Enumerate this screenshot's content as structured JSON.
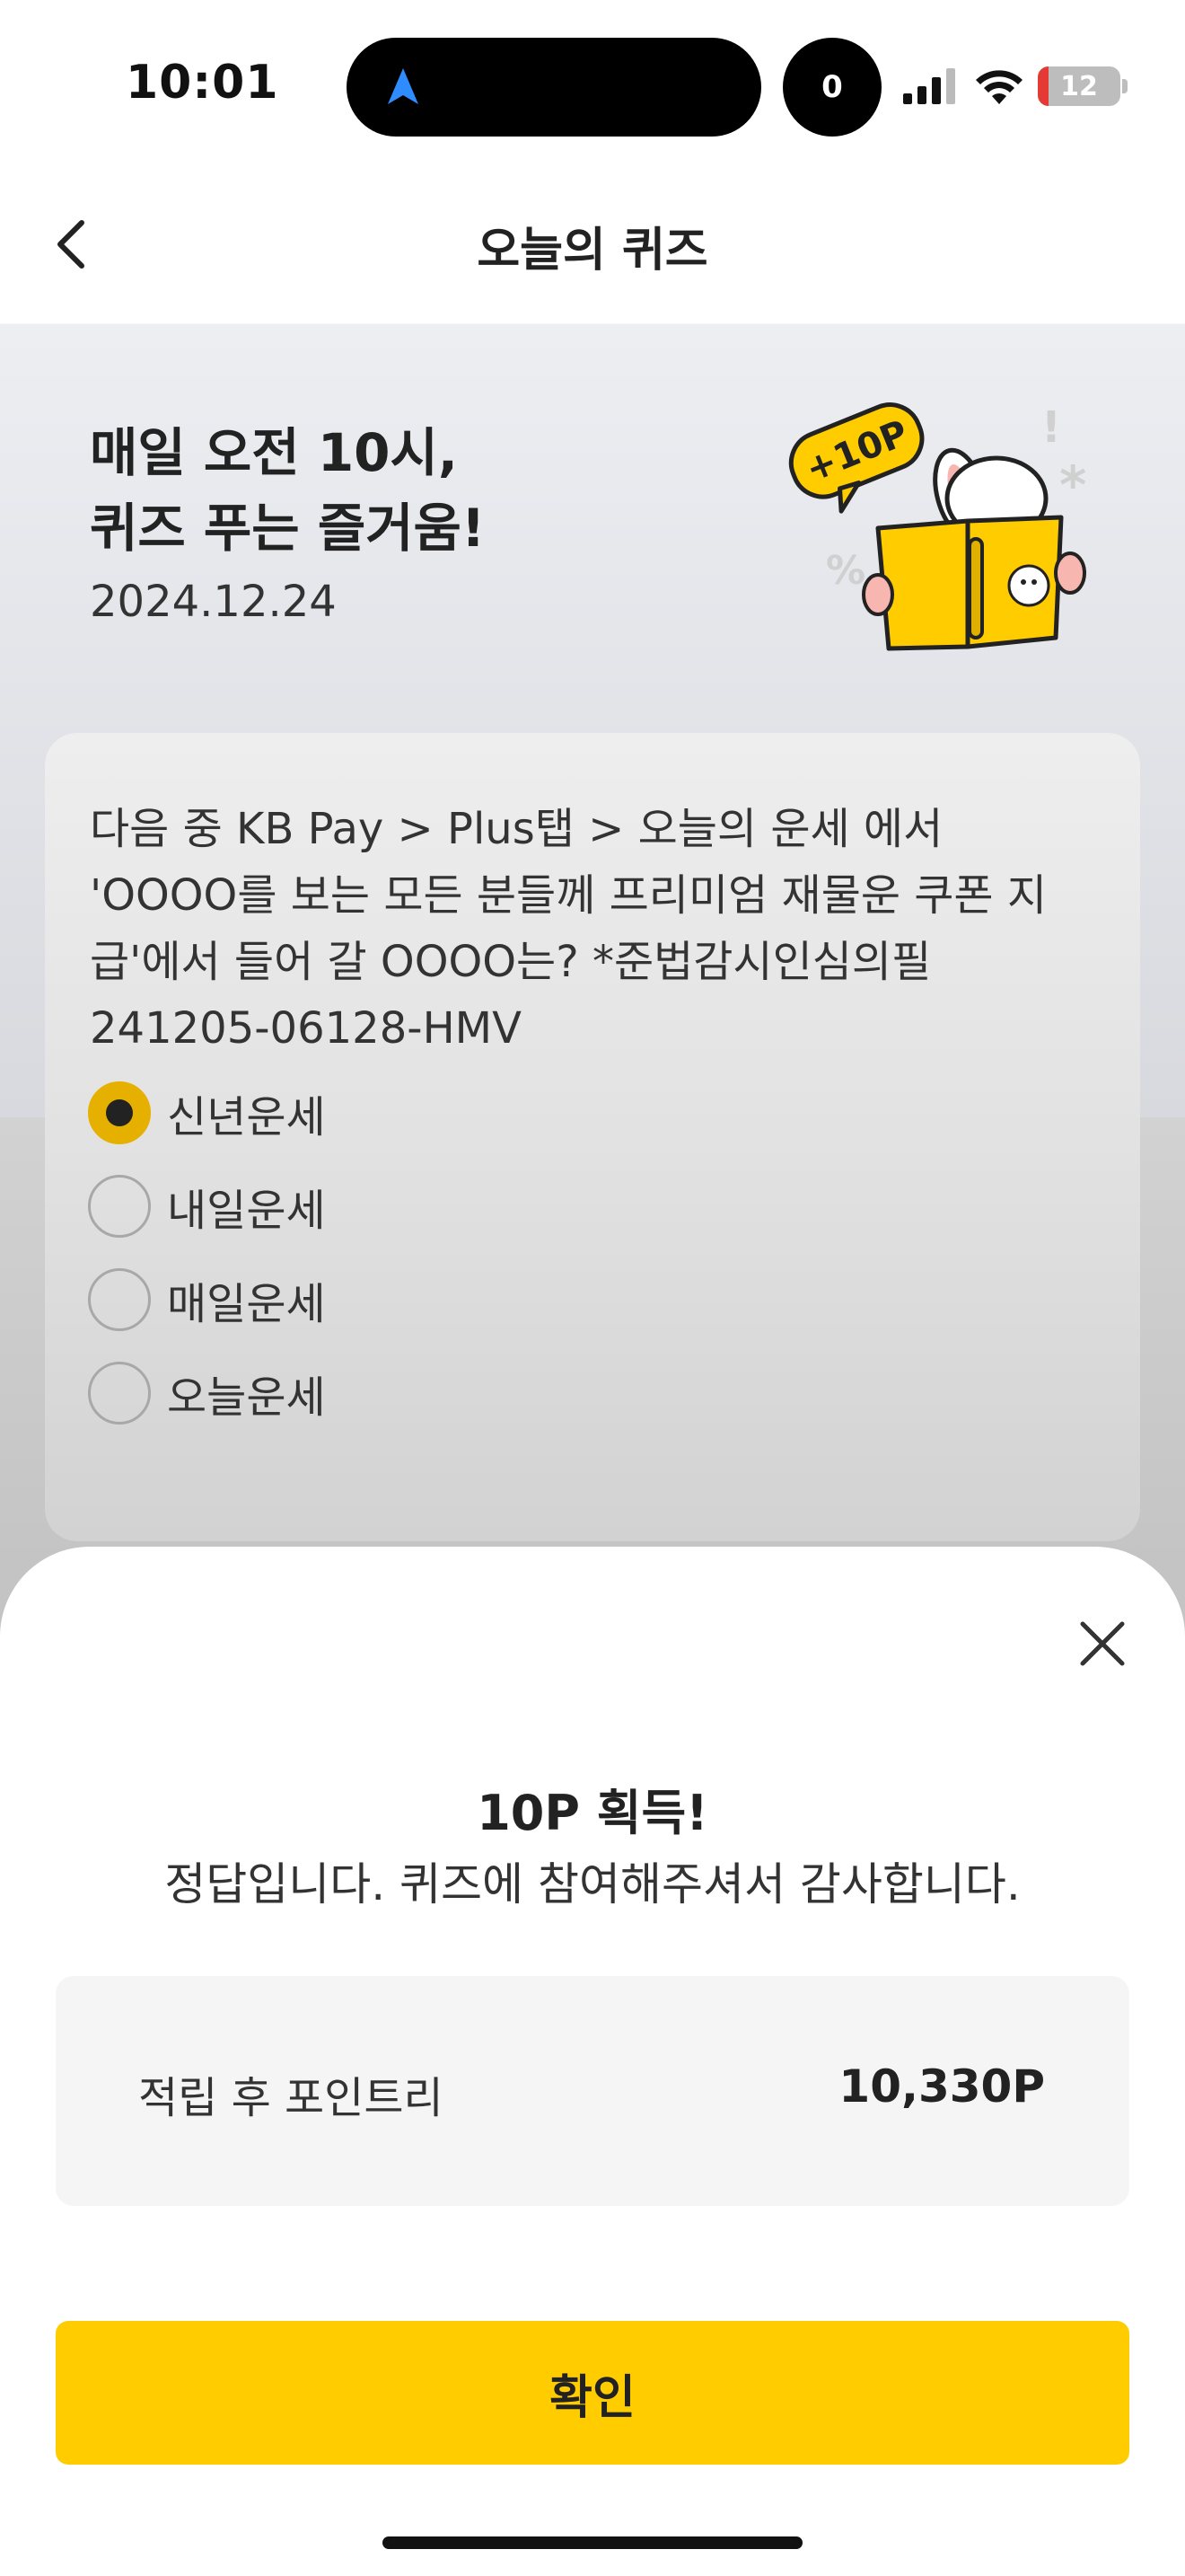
{
  "status_bar": {
    "time": "10:01",
    "notification_count": "0",
    "battery": "12"
  },
  "header": {
    "title": "오늘의 퀴즈"
  },
  "hero": {
    "title": "매일 오전 10시,\n퀴즈 푸는 즐거움!",
    "date": "2024.12.24",
    "badge": "+10P"
  },
  "quiz": {
    "question": "다음 중 KB Pay > Plus탭 > 오늘의 운세 에서 'OOOO를 보는 모든 분들께 프리미엄 재물운 쿠폰 지급'에서 들어 갈 OOOO는? *준법감시인심의필 241205-06128-HMV",
    "options": [
      {
        "label": "신년운세",
        "selected": true
      },
      {
        "label": "내일운세",
        "selected": false
      },
      {
        "label": "매일운세",
        "selected": false
      },
      {
        "label": "오늘운세",
        "selected": false
      }
    ]
  },
  "result_sheet": {
    "title": "10P 획득!",
    "message": "정답입니다. 퀴즈에 참여해주셔서 감사합니다.",
    "points_label": "적립 후 포인트리",
    "points_value": "10,330P",
    "confirm_label": "확인"
  },
  "colors": {
    "accent": "#ffcc00",
    "radio_selected": "#e6b000"
  }
}
